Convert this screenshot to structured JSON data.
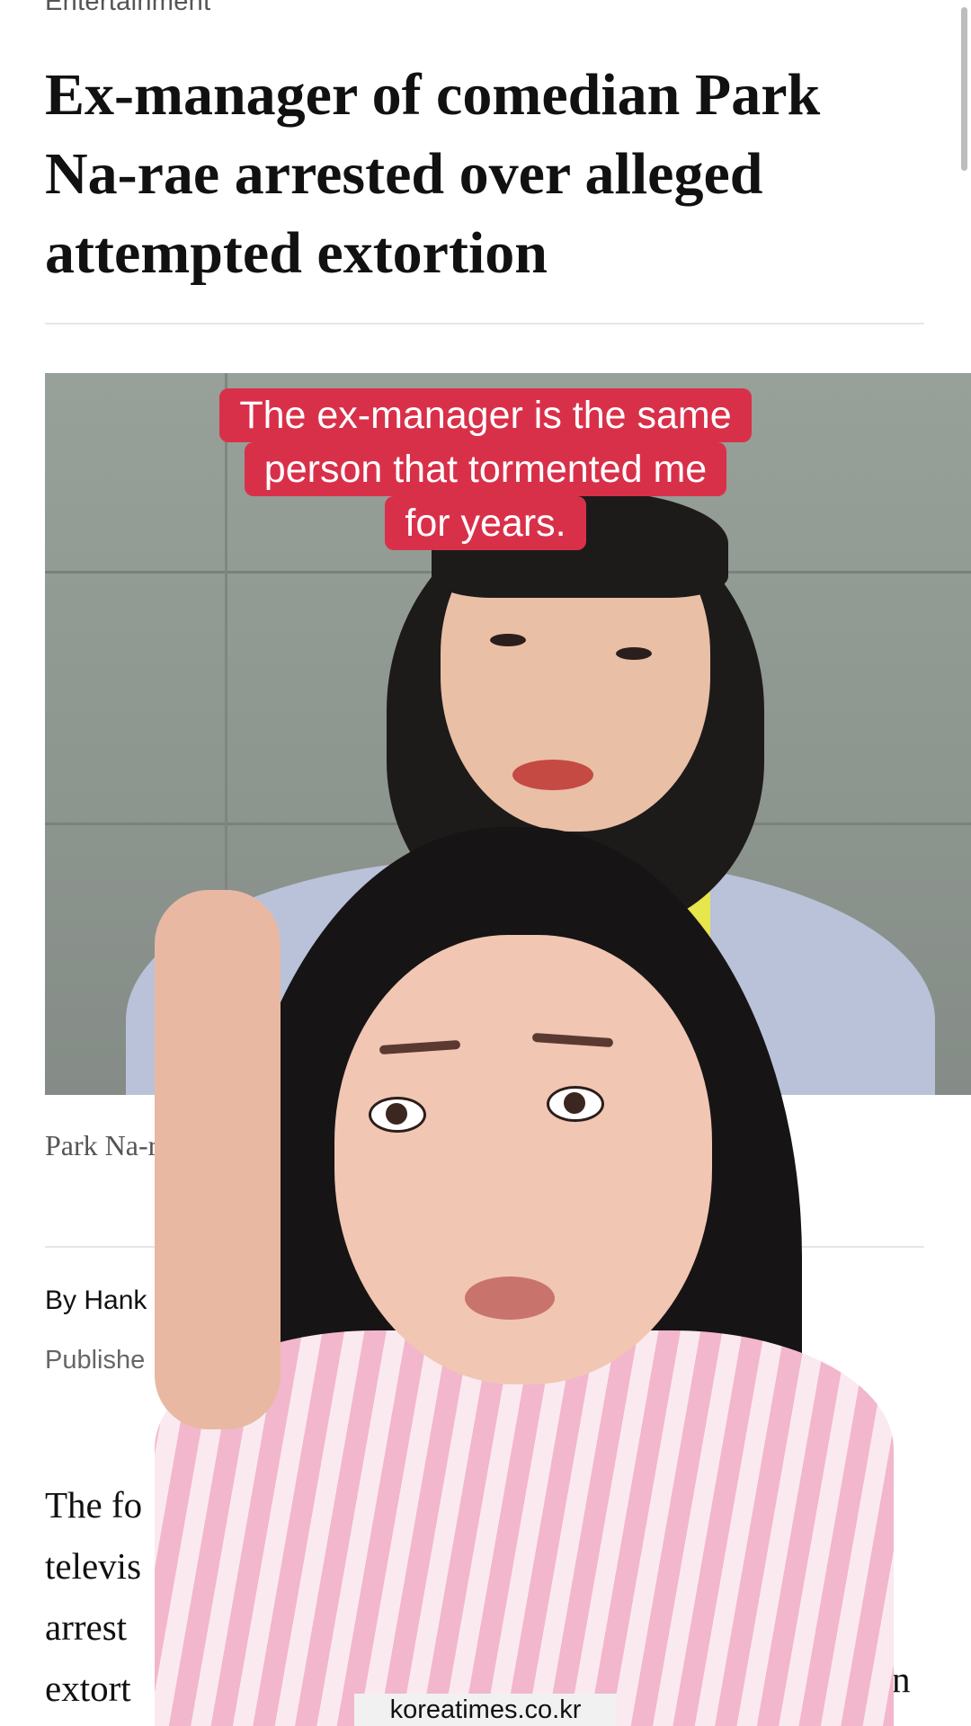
{
  "article": {
    "section": "Entertainment",
    "headline": "Ex-manager of comedian Park Na-rae arrested over alleged attempted extortion",
    "photo_caption": "Park Na-ra",
    "byline": "By Hank",
    "published": "Publishe",
    "body_lines": [
      "The fo",
      "televis",
      "arrest",
      "extort"
    ],
    "body_tail": "n"
  },
  "overlay": {
    "caption_lines": [
      "The ex-manager is the same",
      "person that tormented me",
      "for years."
    ],
    "caption_color": "#d9304a",
    "source": "koreatimes.co.kr"
  }
}
